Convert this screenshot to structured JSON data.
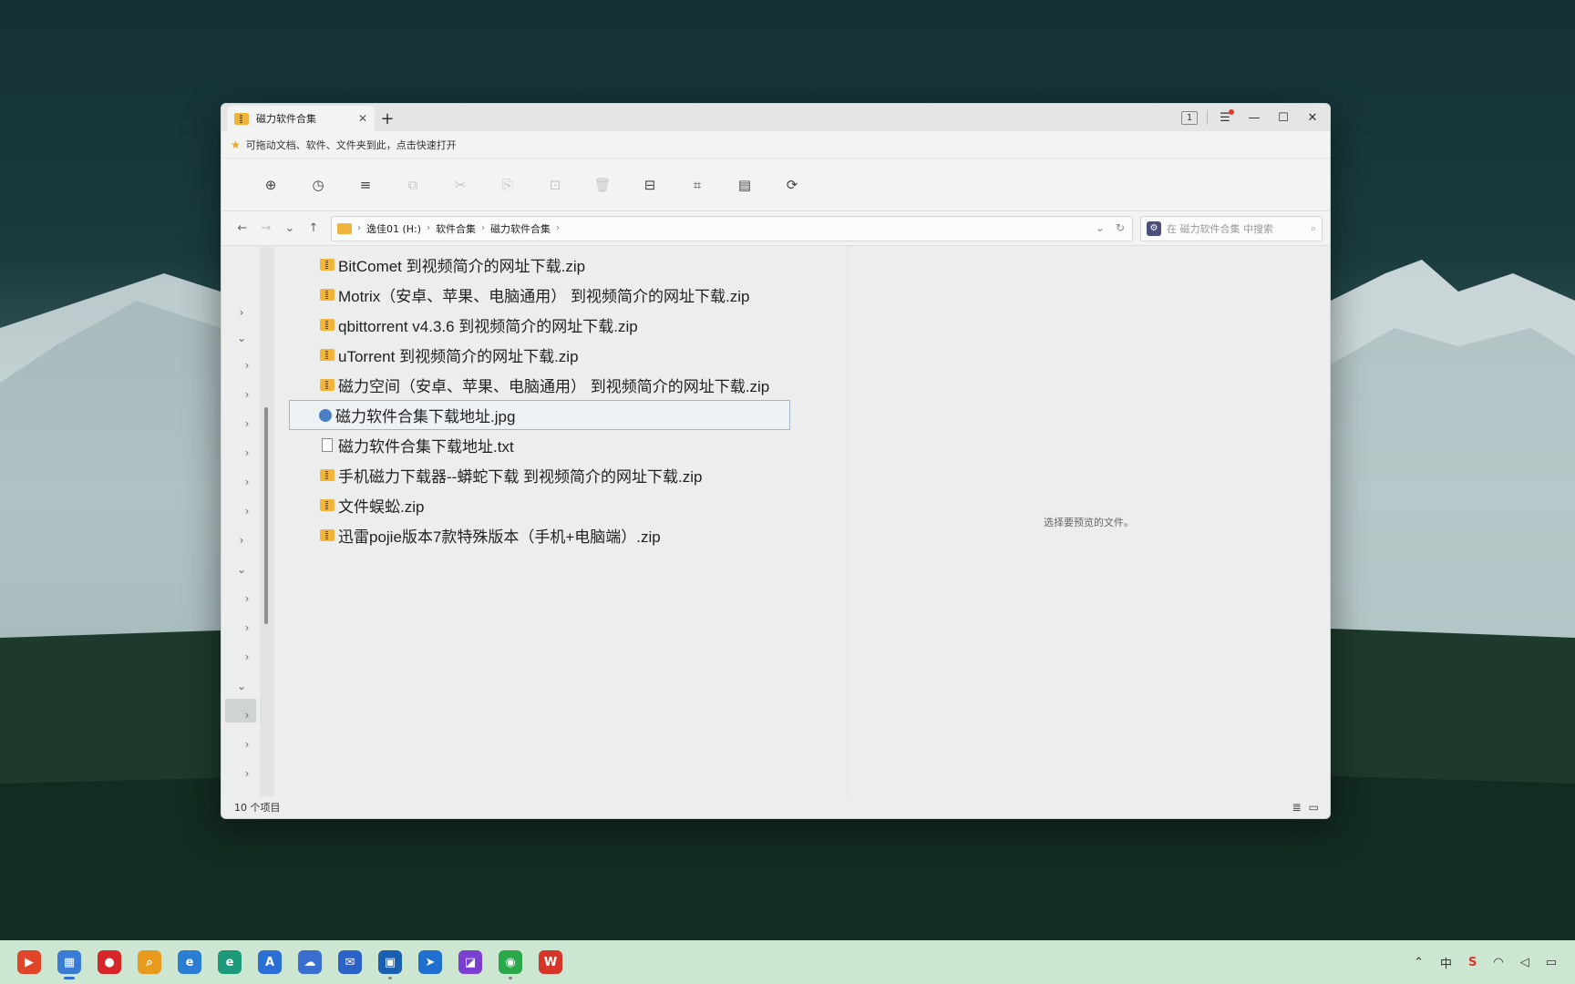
{
  "window": {
    "tab_title": "磁力软件合集",
    "tab_close": "✕",
    "new_tab": "+",
    "tab_count": "1",
    "controls": {
      "menu": "☰",
      "minimize": "—",
      "maximize": "☐",
      "close": "✕"
    },
    "favorites_hint": "可拖动文档、软件、文件夹到此，点击快速打开",
    "toolbar": [
      {
        "name": "new-item",
        "icon": "⊕",
        "enabled": true
      },
      {
        "name": "history",
        "icon": "◷",
        "enabled": true
      },
      {
        "name": "view-mode",
        "icon": "≡",
        "enabled": true
      },
      {
        "name": "copy",
        "icon": "⧉",
        "enabled": false
      },
      {
        "name": "cut",
        "icon": "✂",
        "enabled": false
      },
      {
        "name": "paste",
        "icon": "⎘",
        "enabled": false
      },
      {
        "name": "rename",
        "icon": "⊡",
        "enabled": false
      },
      {
        "name": "delete",
        "icon": "🗑",
        "enabled": false
      },
      {
        "name": "archive",
        "icon": "⊟",
        "enabled": true
      },
      {
        "name": "crop",
        "icon": "⌗",
        "enabled": true
      },
      {
        "name": "calculator",
        "icon": "▤",
        "enabled": true
      },
      {
        "name": "refresh-sync",
        "icon": "⟳",
        "enabled": true
      }
    ],
    "nav": {
      "back": "←",
      "forward": "→",
      "recent": "⌄",
      "up": "↑"
    },
    "breadcrumb": [
      "逸佳01 (H:)",
      "软件合集",
      "磁力软件合集"
    ],
    "breadcrumb_sep": "›",
    "address_dropdown": "⌄",
    "address_refresh": "↻",
    "search_placeholder": "在 磁力软件合集 中搜索",
    "search_gear": "⚙",
    "search_icon": "⌕",
    "files": [
      {
        "name": "BitComet  到视频简介的网址下载.zip",
        "type": "zip",
        "selected": false
      },
      {
        "name": "Motrix（安卓、苹果、电脑通用） 到视频简介的网址下载.zip",
        "type": "zip",
        "selected": false
      },
      {
        "name": "qbittorrent v4.3.6  到视频简介的网址下载.zip",
        "type": "zip",
        "selected": false
      },
      {
        "name": "uTorrent  到视频简介的网址下载.zip",
        "type": "zip",
        "selected": false
      },
      {
        "name": "磁力空间（安卓、苹果、电脑通用） 到视频简介的网址下载.zip",
        "type": "zip",
        "selected": false
      },
      {
        "name": "磁力软件合集下载地址.jpg",
        "type": "img",
        "selected": true
      },
      {
        "name": "磁力软件合集下载地址.txt",
        "type": "txt",
        "selected": false
      },
      {
        "name": "手机磁力下载器--蟒蛇下载  到视频简介的网址下载.zip",
        "type": "zip",
        "selected": false
      },
      {
        "name": "文件蜈蚣.zip",
        "type": "zip",
        "selected": false
      },
      {
        "name": "迅雷pojie版本7款特殊版本（手机+电脑端）.zip",
        "type": "zip",
        "selected": false
      }
    ],
    "preview_text": "选择要预览的文件。",
    "status": "10 个项目",
    "status_views": {
      "details": "≣",
      "preview": "▭"
    }
  },
  "taskbar": {
    "apps": [
      {
        "name": "app-red-flag",
        "color": "#e0452a",
        "glyph": "▶",
        "state": ""
      },
      {
        "name": "file-manager",
        "color": "#3a7bd5",
        "glyph": "▦",
        "state": "active"
      },
      {
        "name": "app-circle-red",
        "color": "#d6262a",
        "glyph": "●",
        "state": ""
      },
      {
        "name": "search-tool",
        "color": "#e89a1c",
        "glyph": "⌕",
        "state": ""
      },
      {
        "name": "browser-ie",
        "color": "#2b7dd4",
        "glyph": "e",
        "state": ""
      },
      {
        "name": "browser-edge",
        "color": "#1d9a7a",
        "glyph": "e",
        "state": ""
      },
      {
        "name": "app-blue-a",
        "color": "#2a6fd6",
        "glyph": "A",
        "state": ""
      },
      {
        "name": "cloud-app",
        "color": "#3a6fd0",
        "glyph": "☁",
        "state": ""
      },
      {
        "name": "mail-app",
        "color": "#2a62c9",
        "glyph": "✉",
        "state": ""
      },
      {
        "name": "screen-app",
        "color": "#1b5fb0",
        "glyph": "▣",
        "state": "run"
      },
      {
        "name": "nav-app",
        "color": "#1f6fcf",
        "glyph": "➤",
        "state": ""
      },
      {
        "name": "design-app",
        "color": "#7a3fd1",
        "glyph": "◪",
        "state": ""
      },
      {
        "name": "wechat-app",
        "color": "#2aa84a",
        "glyph": "◉",
        "state": "run"
      },
      {
        "name": "wps-app",
        "color": "#d8352a",
        "glyph": "W",
        "state": ""
      }
    ],
    "tray": {
      "chevron": "⌃",
      "ime": "中",
      "app": "S",
      "wifi": "◠",
      "volume": "◁",
      "battery": "▭"
    }
  }
}
